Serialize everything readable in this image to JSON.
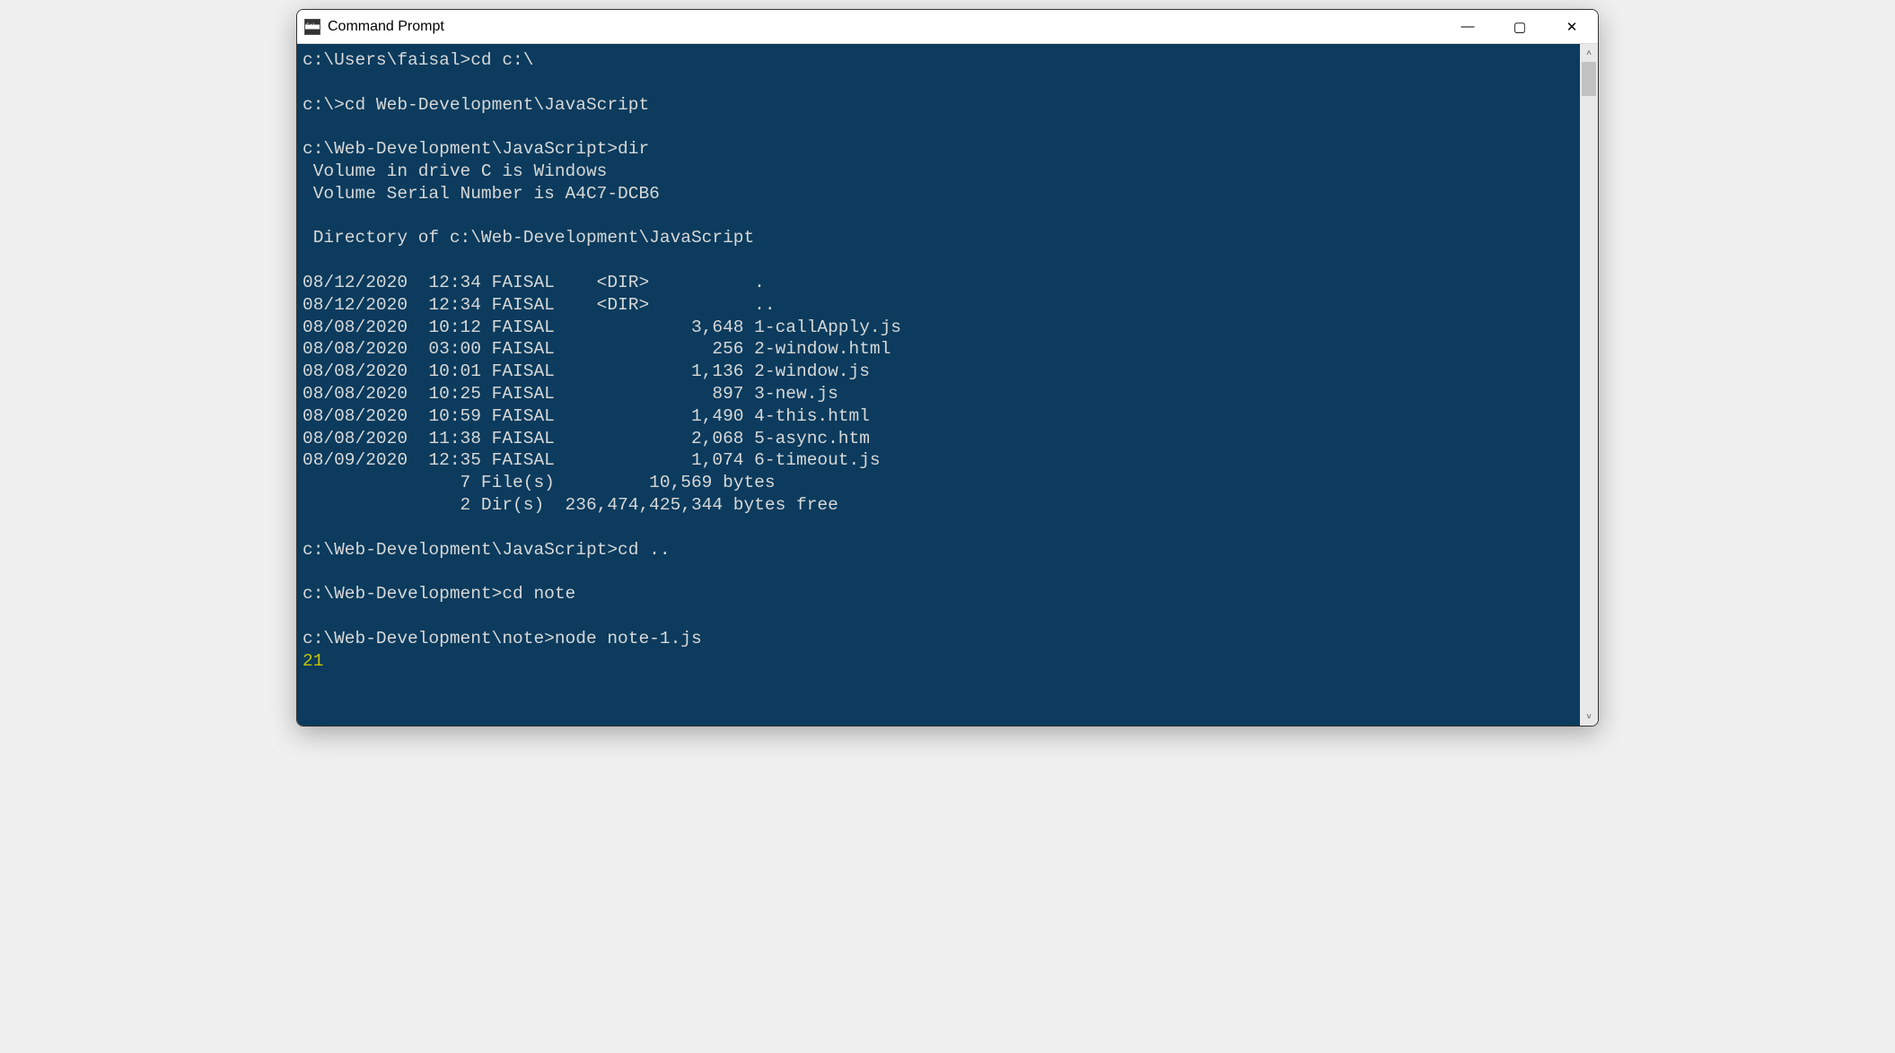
{
  "window": {
    "title": "Command Prompt",
    "min_glyph": "—",
    "max_glyph": "▢",
    "close_glyph": "✕"
  },
  "scrollbar": {
    "up_glyph": "˄",
    "down_glyph": "˅"
  },
  "colors": {
    "terminal_bg": "#0c3b5d",
    "terminal_fg": "#d6d8d8",
    "output_yellow": "#c7c400"
  },
  "session": {
    "commands": [
      {
        "prompt": "c:\\Users\\faisal>",
        "input": "cd c:\\"
      },
      {
        "prompt": "c:\\>",
        "input": "cd Web-Development\\JavaScript"
      },
      {
        "prompt": "c:\\Web-Development\\JavaScript>",
        "input": "dir"
      },
      {
        "prompt": "c:\\Web-Development\\JavaScript>",
        "input": "cd .."
      },
      {
        "prompt": "c:\\Web-Development>",
        "input": "cd note"
      },
      {
        "prompt": "c:\\Web-Development\\note>",
        "input": "node note-1.js"
      }
    ],
    "dir_output": {
      "volume_line": " Volume in drive C is Windows",
      "serial_line": " Volume Serial Number is A4C7-DCB6",
      "directory_line": " Directory of c:\\Web-Development\\JavaScript",
      "entries": [
        {
          "date": "08/12/2020",
          "time": "12:34",
          "user": "FAISAL",
          "size_or_dir": "<DIR>",
          "name": "."
        },
        {
          "date": "08/12/2020",
          "time": "12:34",
          "user": "FAISAL",
          "size_or_dir": "<DIR>",
          "name": ".."
        },
        {
          "date": "08/08/2020",
          "time": "10:12",
          "user": "FAISAL",
          "size_or_dir": "3,648",
          "name": "1-callApply.js"
        },
        {
          "date": "08/08/2020",
          "time": "03:00",
          "user": "FAISAL",
          "size_or_dir": "256",
          "name": "2-window.html"
        },
        {
          "date": "08/08/2020",
          "time": "10:01",
          "user": "FAISAL",
          "size_or_dir": "1,136",
          "name": "2-window.js"
        },
        {
          "date": "08/08/2020",
          "time": "10:25",
          "user": "FAISAL",
          "size_or_dir": "897",
          "name": "3-new.js"
        },
        {
          "date": "08/08/2020",
          "time": "10:59",
          "user": "FAISAL",
          "size_or_dir": "1,490",
          "name": "4-this.html"
        },
        {
          "date": "08/08/2020",
          "time": "11:38",
          "user": "FAISAL",
          "size_or_dir": "2,068",
          "name": "5-async.htm"
        },
        {
          "date": "08/09/2020",
          "time": "12:35",
          "user": "FAISAL",
          "size_or_dir": "1,074",
          "name": "6-timeout.js"
        }
      ],
      "summary_files": "               7 File(s)         10,569 bytes",
      "summary_dirs": "               2 Dir(s)  236,474,425,344 bytes free"
    },
    "node_output": "21"
  },
  "lines": [
    "c:\\Users\\faisal>cd c:\\",
    "",
    "c:\\>cd Web-Development\\JavaScript",
    "",
    "c:\\Web-Development\\JavaScript>dir",
    " Volume in drive C is Windows",
    " Volume Serial Number is A4C7-DCB6",
    "",
    " Directory of c:\\Web-Development\\JavaScript",
    "",
    "08/12/2020  12:34 FAISAL    <DIR>          .",
    "08/12/2020  12:34 FAISAL    <DIR>          ..",
    "08/08/2020  10:12 FAISAL             3,648 1-callApply.js",
    "08/08/2020  03:00 FAISAL               256 2-window.html",
    "08/08/2020  10:01 FAISAL             1,136 2-window.js",
    "08/08/2020  10:25 FAISAL               897 3-new.js",
    "08/08/2020  10:59 FAISAL             1,490 4-this.html",
    "08/08/2020  11:38 FAISAL             2,068 5-async.htm",
    "08/09/2020  12:35 FAISAL             1,074 6-timeout.js",
    "               7 File(s)         10,569 bytes",
    "               2 Dir(s)  236,474,425,344 bytes free",
    "",
    "c:\\Web-Development\\JavaScript>cd ..",
    "",
    "c:\\Web-Development>cd note",
    "",
    "c:\\Web-Development\\note>node note-1.js"
  ]
}
